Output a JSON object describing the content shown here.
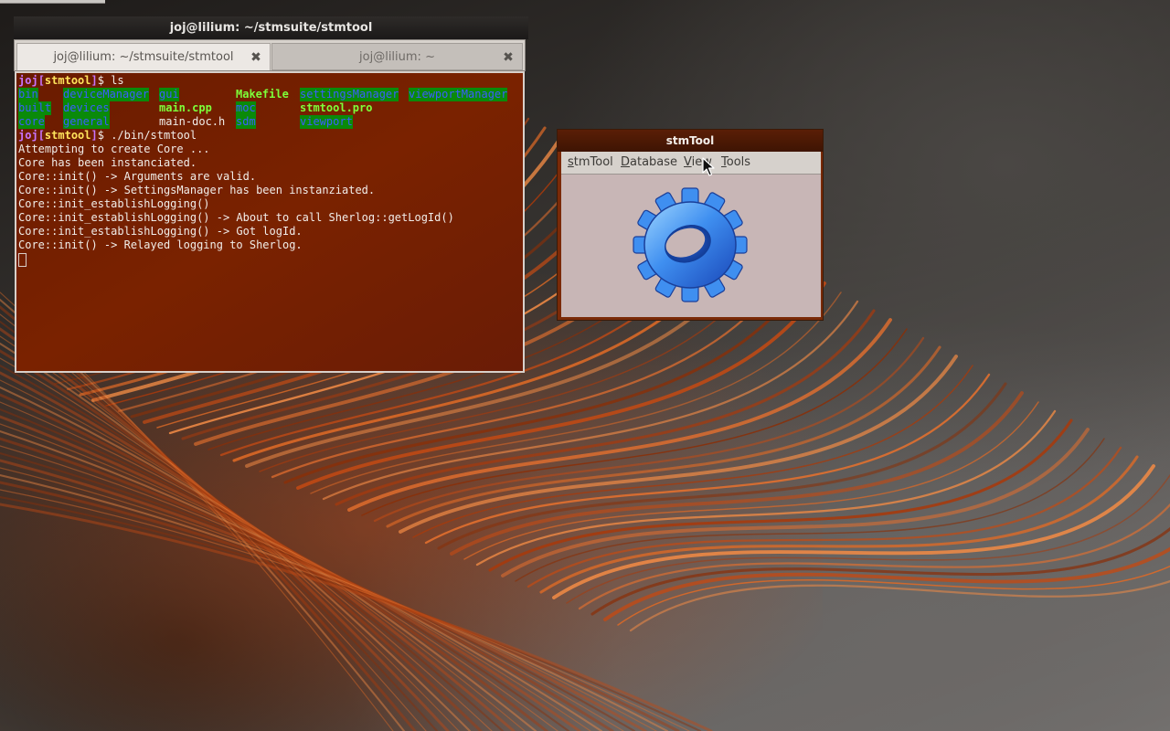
{
  "terminal": {
    "window_title": "joj@lilium: ~/stmsuite/stmtool",
    "tabs": [
      {
        "label": "joj@lilium: ~/stmsuite/stmtool",
        "close_icon": "✖"
      },
      {
        "label": "joj@lilium: ~",
        "close_icon": "✖"
      }
    ],
    "prompt": {
      "user": "joj",
      "dir": "stmtool",
      "open": "[",
      "close": "]",
      "symbol": "$"
    },
    "commands": {
      "first": " ls",
      "second": " ./bin/stmtool"
    },
    "ls_output": [
      [
        {
          "text": "bin",
          "kind": "dir"
        },
        {
          "text": "deviceManager",
          "kind": "dir"
        },
        {
          "text": "gui",
          "kind": "dir"
        },
        {
          "text": "Makefile",
          "kind": "exe"
        },
        {
          "text": "settingsManager",
          "kind": "dir"
        },
        {
          "text": "viewportManager",
          "kind": "dir"
        }
      ],
      [
        {
          "text": "built",
          "kind": "dir"
        },
        {
          "text": "devices",
          "kind": "dir"
        },
        {
          "text": "main.cpp",
          "kind": "exe"
        },
        {
          "text": "moc",
          "kind": "dir"
        },
        {
          "text": "stmtool.pro",
          "kind": "exe"
        }
      ],
      [
        {
          "text": "core",
          "kind": "dir"
        },
        {
          "text": "general",
          "kind": "dir"
        },
        {
          "text": "main-doc.h",
          "kind": "plain"
        },
        {
          "text": "sdm",
          "kind": "dir"
        },
        {
          "text": "viewport",
          "kind": "dir"
        }
      ]
    ],
    "output_lines": [
      "Attempting to create Core ...",
      "Core has been instanciated.",
      "Core::init() -> Arguments are valid.",
      "Core::init() -> SettingsManager has been instanziated.",
      "Core::init_establishLogging()",
      "Core::init_establishLogging() -> About to call Sherlog::getLogId()",
      "Core::init_establishLogging() -> Got logId.",
      "Core::init() -> Relayed logging to Sherlog."
    ],
    "colors": {
      "background": "#731f00",
      "dir_bg": "#0a8a0a",
      "dir_fg": "#3b5dff",
      "exe_fg": "#7dff3a",
      "prompt_user": "#c874ff",
      "prompt_dir": "#ffe45c"
    }
  },
  "stmtool": {
    "window_title": "stmTool",
    "menu": [
      {
        "label": "stmTool",
        "accel": "s",
        "rest": "tmTool"
      },
      {
        "label": "Database",
        "accel": "D",
        "rest": "atabase"
      },
      {
        "label": "View",
        "accel": "V",
        "rest": "iew"
      },
      {
        "label": "Tools",
        "accel": "T",
        "rest": "ools"
      }
    ],
    "content_icon": "gear-icon"
  },
  "desktop": {
    "wallpaper": "orange-feather",
    "cursor_icon": "mouse-pointer-icon"
  }
}
